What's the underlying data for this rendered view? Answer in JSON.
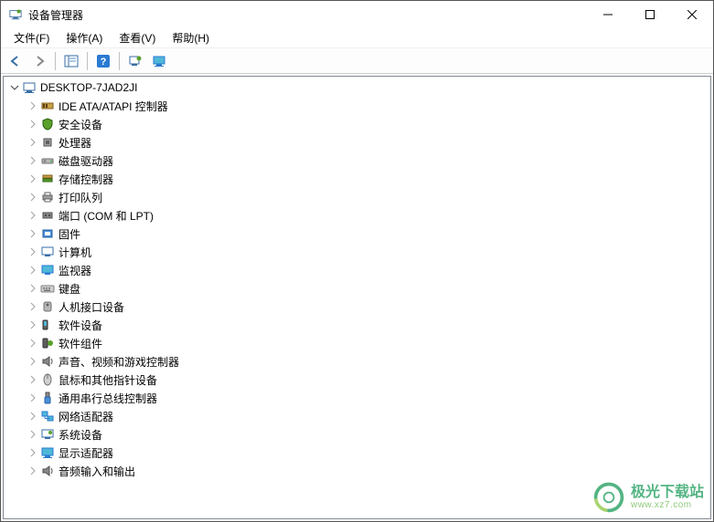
{
  "window": {
    "title": "设备管理器"
  },
  "menu": {
    "file": "文件(F)",
    "action": "操作(A)",
    "view": "查看(V)",
    "help": "帮助(H)"
  },
  "toolbar_icons": {
    "back": "back-icon",
    "forward": "forward-icon",
    "show_hide": "show-hide-icon",
    "help": "help-icon",
    "scan": "scan-icon",
    "monitor": "monitor-icon"
  },
  "tree": {
    "root": {
      "label": "DESKTOP-7JAD2JI",
      "expanded": true
    },
    "children": [
      {
        "label": "IDE ATA/ATAPI 控制器",
        "icon": "ide-icon"
      },
      {
        "label": "安全设备",
        "icon": "security-icon"
      },
      {
        "label": "处理器",
        "icon": "processor-icon"
      },
      {
        "label": "磁盘驱动器",
        "icon": "disk-icon"
      },
      {
        "label": "存储控制器",
        "icon": "storage-icon"
      },
      {
        "label": "打印队列",
        "icon": "printer-icon"
      },
      {
        "label": "端口 (COM 和 LPT)",
        "icon": "port-icon"
      },
      {
        "label": "固件",
        "icon": "firmware-icon"
      },
      {
        "label": "计算机",
        "icon": "computer-icon"
      },
      {
        "label": "监视器",
        "icon": "monitor-device-icon"
      },
      {
        "label": "键盘",
        "icon": "keyboard-icon"
      },
      {
        "label": "人机接口设备",
        "icon": "hid-icon"
      },
      {
        "label": "软件设备",
        "icon": "software-device-icon"
      },
      {
        "label": "软件组件",
        "icon": "software-component-icon"
      },
      {
        "label": "声音、视频和游戏控制器",
        "icon": "sound-icon"
      },
      {
        "label": "鼠标和其他指针设备",
        "icon": "mouse-icon"
      },
      {
        "label": "通用串行总线控制器",
        "icon": "usb-icon"
      },
      {
        "label": "网络适配器",
        "icon": "network-icon"
      },
      {
        "label": "系统设备",
        "icon": "system-icon"
      },
      {
        "label": "显示适配器",
        "icon": "display-icon"
      },
      {
        "label": "音频输入和输出",
        "icon": "audio-io-icon"
      }
    ]
  },
  "watermark": {
    "name": "极光下载站",
    "url": "www.xz7.com"
  }
}
